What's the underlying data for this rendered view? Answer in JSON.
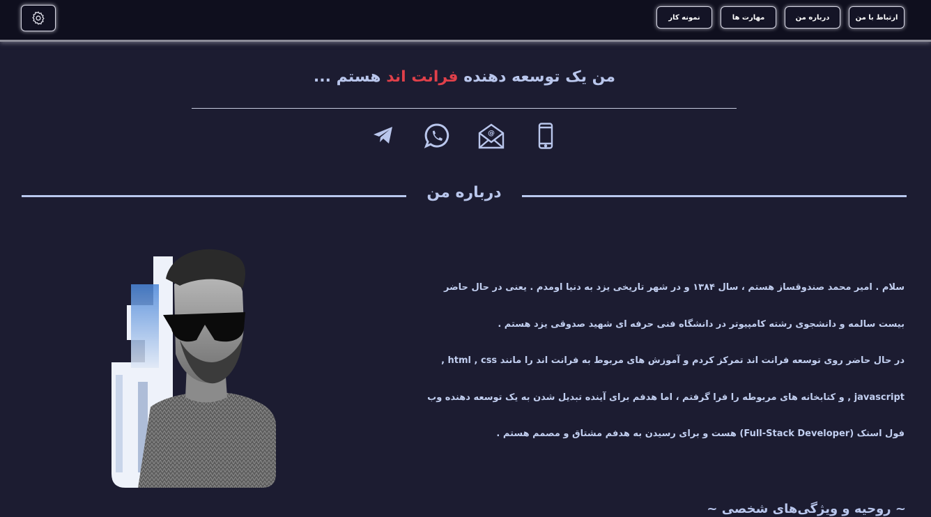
{
  "nav": {
    "items": [
      "ارتباط با من",
      "درباره من",
      "مهارت ها",
      "نمونه کار"
    ]
  },
  "settings_icon": "gear-icon",
  "hero": {
    "title_part1": "من یک توسعه دهنده ",
    "title_accent": "فرانت اند",
    "title_part2": " هستم ...",
    "accent_color": "#e0404a"
  },
  "contacts": [
    "phone-icon",
    "email-icon",
    "whatsapp-icon",
    "telegram-icon"
  ],
  "about": {
    "heading": "درباره من",
    "lines": [
      "سلام . امیر محمد صندوقساز هستم ، سال ۱۳۸۴ و در شهر تاریخی یزد به دنیا اومدم . یعنی در حال حاضر",
      "بیست سالمه و دانشجوی رشته کامپیوتر در دانشگاه فنی حرفه ای شهید صدوقی یزد هستم .",
      "در حال حاضر روی توسعه فرانت اند تمرکز کردم و آموزش های مربوط به فرانت اند را مانند html , css ,",
      "javascript , و کتابخانه های مربوطه را فرا گرفتم ، اما هدفم برای آینده تبدیل شدن به یک توسعه دهنده وب",
      "فول استک (Full-Stack Developer) هست و برای رسیدن به هدفم مشتاق و مصمم هستم ."
    ]
  },
  "traits_heading": "~ روحیه و ویژگی‌های شخصی ~",
  "colors": {
    "background": "#1c1c31",
    "topbar": "#0f0f1e",
    "text": "#b9c6ec"
  }
}
